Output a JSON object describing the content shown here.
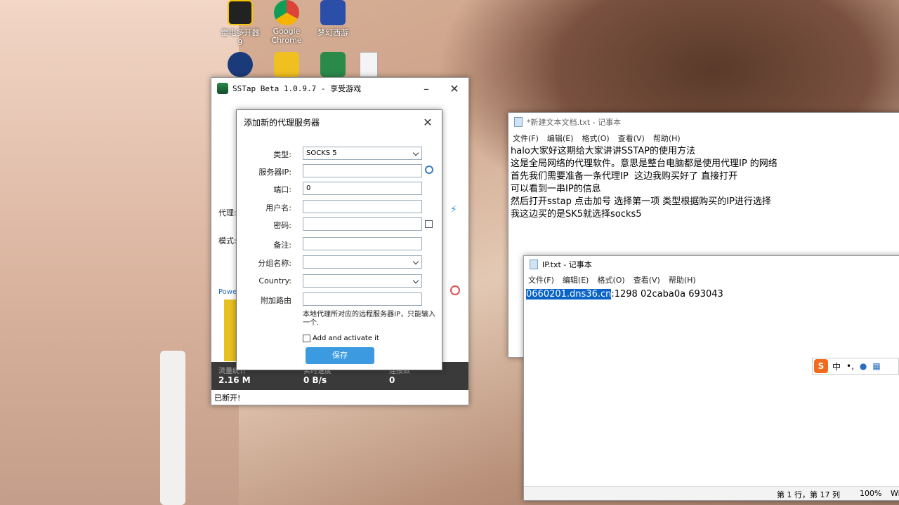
{
  "desktop": {
    "icons": [
      {
        "label": "雷电多开器9"
      },
      {
        "label": "Google Chrome"
      },
      {
        "label": "梦幻西游"
      }
    ]
  },
  "sstap": {
    "title": "SSTap Beta 1.0.9.7 - 享受游戏",
    "proxy_label": "代理:",
    "mode_label": "模式:",
    "powered": "Power",
    "stats": [
      {
        "label": "流量统计",
        "value": "2.16 M"
      },
      {
        "label": "实时速度",
        "value": "0 B/s"
      },
      {
        "label": "连接数",
        "value": "0"
      }
    ],
    "status": "已断开!"
  },
  "dialog": {
    "title": "添加新的代理服务器",
    "fields": {
      "type_label": "类型:",
      "type_value": "SOCKS 5",
      "server_label": "服务器IP:",
      "server_value": "",
      "port_label": "端口:",
      "port_value": "0",
      "user_label": "用户名:",
      "user_value": "",
      "pass_label": "密码:",
      "pass_value": "",
      "note_label": "备注:",
      "note_value": "",
      "group_label": "分组名称:",
      "group_value": "",
      "country_label": "Country:",
      "country_value": "",
      "route_label": "附加路由",
      "route_value": ""
    },
    "hint": "本地代理所对应的远程服务器IP，只能输入一个.",
    "activate_label": "Add and activate it",
    "save_label": "保存"
  },
  "notepad1": {
    "title": "*新建文本文档.txt - 记事本",
    "menu": [
      "文件(F)",
      "编辑(E)",
      "格式(O)",
      "查看(V)",
      "帮助(H)"
    ],
    "lines": [
      "halo大家好这期给大家讲讲SSTAP的使用方法",
      "这是全局网络的代理软件。意思是整台电脑都是使用代理IP 的网络",
      "首先我们需要准备一条代理IP  这边我购买好了 直接打开",
      "可以看到一串IP的信息",
      "然后打开sstap 点击加号 选择第一项 类型根据购买的IP进行选择",
      "我这边买的是SK5就选择socks5"
    ]
  },
  "notepad2": {
    "title": "IP.txt - 记事本",
    "menu": [
      "文件(F)",
      "编辑(E)",
      "格式(O)",
      "查看(V)",
      "帮助(H)"
    ],
    "selected": "0660201.dns36.cn",
    "rest": ":1298 02caba0a 693043",
    "status_pos": "第 1 行，第 17 列",
    "status_zoom": "100%",
    "status_enc": "Wi"
  },
  "ime": {
    "logo": "S",
    "lang": "中",
    "punct": "•,"
  }
}
